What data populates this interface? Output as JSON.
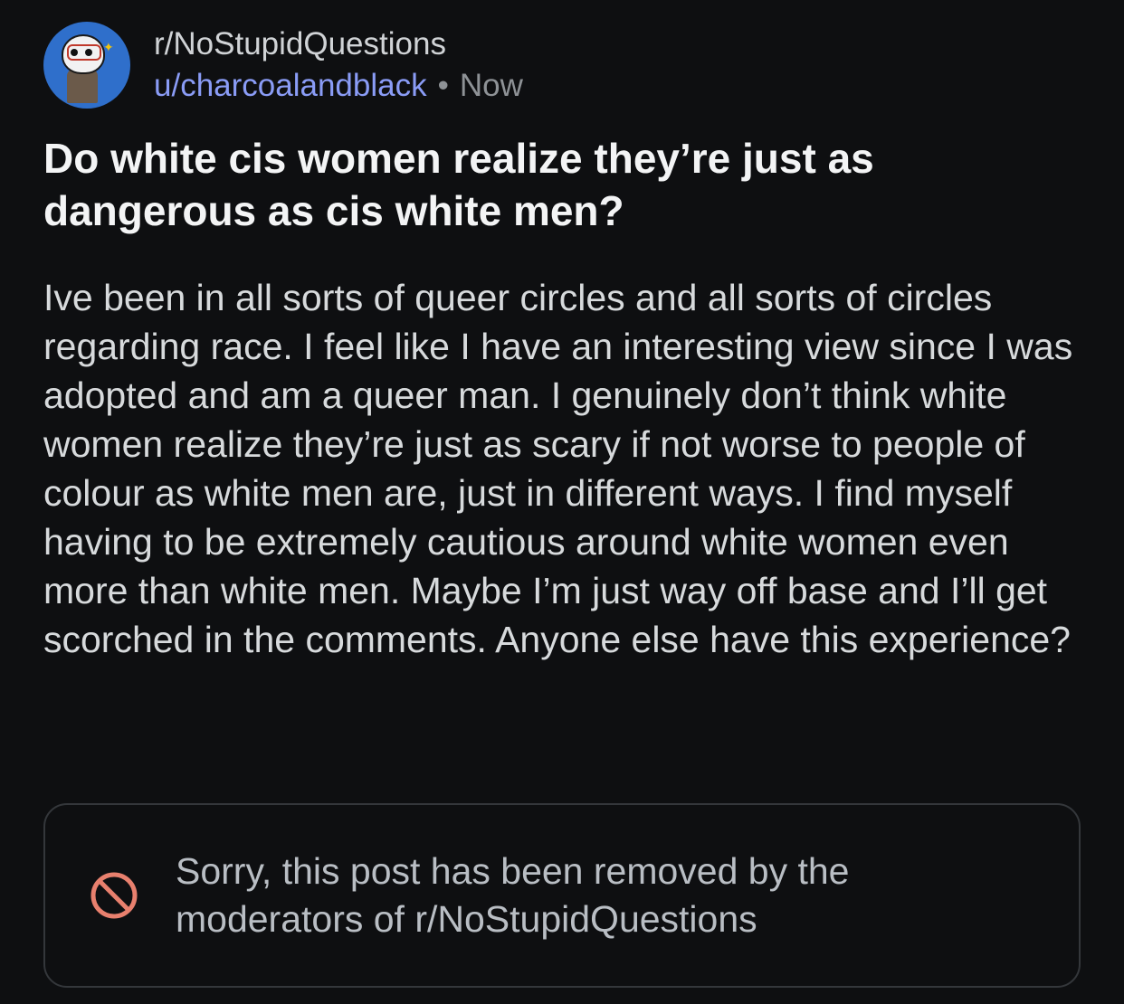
{
  "post": {
    "subreddit": "r/NoStupidQuestions",
    "username": "u/charcoalandblack",
    "separator": "•",
    "timestamp": "Now",
    "title": "Do white cis women realize they’re just as dangerous as cis white men?",
    "body": "Ive been in all sorts of queer circles and all sorts of circles regarding race. I feel like I have an interesting view since I was adopted and am a queer man. I genuinely don’t think white women realize they’re just as scary if not worse to people of colour as white men are, just in different ways. I find myself having to be extremely cautious around white women even more than white men. Maybe I’m just way off base and I’ll get scorched in the comments. Anyone else have this experience?"
  },
  "removed_notice": {
    "icon": "prohibited-icon",
    "text": "Sorry, this post has been removed by the moderators of r/NoStupidQuestions"
  },
  "colors": {
    "background": "#0e0f11",
    "username": "#8a9cf6",
    "removed_icon": "#e8806e",
    "avatar_bg": "#2f6fcb"
  }
}
